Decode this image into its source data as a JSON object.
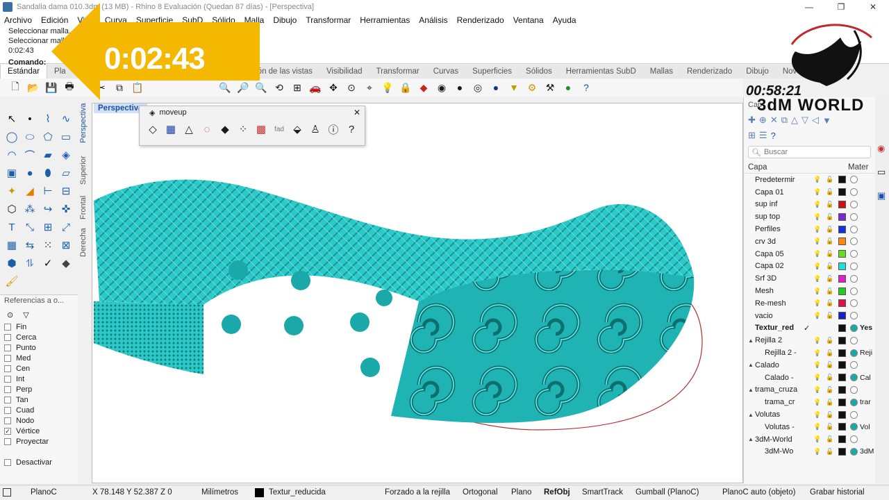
{
  "window": {
    "title": "Sandalia dama 010.3dm (13 MB) - Rhino 8 Evaluación (Quedan 87 días) - [Perspectiva]",
    "controls": [
      "—",
      "❐",
      "✕"
    ]
  },
  "menu": [
    "Archivo",
    "Edición",
    "Vista",
    "Curva",
    "Superficie",
    "SubD",
    "Sólido",
    "Malla",
    "Dibujo",
    "Transformar",
    "Herramientas",
    "Análisis",
    "Renderizado",
    "Ventana",
    "Ayuda"
  ],
  "command": {
    "history": [
      "Seleccionar malla... Pulse Intro cuando termine",
      "Seleccionar malla... Pulse Intro cuando termine",
      "0:02:43"
    ],
    "prompt_label": "Comando:",
    "prompt_value": ""
  },
  "timer": {
    "value": "0:02:43",
    "color": "#f5b800"
  },
  "tabs": [
    "Estándar",
    "Pla",
    "Disposición de las vistas",
    "Visibilidad",
    "Transformar",
    "Curvas",
    "Superficies",
    "Sólidos",
    "Herramientas SubD",
    "Mallas",
    "Renderizado",
    "Dibujo",
    "Nove"
  ],
  "viewport": {
    "active_label": "Perspectiva",
    "side_tabs": [
      "Perspectiva",
      "Superior",
      "Frontal",
      "Derecha"
    ],
    "model_color": "#2cc9c9",
    "curve_color": "#b03030"
  },
  "floating_toolbar": {
    "title": "moveup",
    "label_fad": "fad"
  },
  "osnap": {
    "header": "Referencias a o...",
    "items": [
      {
        "label": "Fin",
        "checked": false
      },
      {
        "label": "Cerca",
        "checked": false
      },
      {
        "label": "Punto",
        "checked": false
      },
      {
        "label": "Med",
        "checked": false
      },
      {
        "label": "Cen",
        "checked": false
      },
      {
        "label": "Int",
        "checked": false
      },
      {
        "label": "Perp",
        "checked": false
      },
      {
        "label": "Tan",
        "checked": false
      },
      {
        "label": "Cuad",
        "checked": false
      },
      {
        "label": "Nodo",
        "checked": false
      },
      {
        "label": "Vértice",
        "checked": true
      },
      {
        "label": "Proyectar",
        "checked": false
      }
    ],
    "deactivate": "Desactivar"
  },
  "layers_panel": {
    "tab_label": "Cap",
    "search_placeholder": "Buscar",
    "col_layer": "Capa",
    "col_material": "Mater",
    "rows": [
      {
        "name": "Predetermir",
        "indent": 0,
        "expander": "",
        "current": false,
        "color": "#111111",
        "material": "",
        "mat_color": "#ffffff"
      },
      {
        "name": "Capa 01",
        "indent": 0,
        "expander": "",
        "current": false,
        "color": "#111111",
        "material": "",
        "mat_color": "#ffffff"
      },
      {
        "name": "sup inf",
        "indent": 0,
        "expander": "",
        "current": false,
        "color": "#cc1111",
        "material": "",
        "mat_color": "#ffffff"
      },
      {
        "name": "sup top",
        "indent": 0,
        "expander": "",
        "current": false,
        "color": "#7a2bd0",
        "material": "",
        "mat_color": "#ffffff"
      },
      {
        "name": "Perfiles",
        "indent": 0,
        "expander": "",
        "current": false,
        "color": "#1133dd",
        "material": "",
        "mat_color": "#ffffff"
      },
      {
        "name": "crv 3d",
        "indent": 0,
        "expander": "",
        "current": false,
        "color": "#ff8811",
        "material": "",
        "mat_color": "#ffffff"
      },
      {
        "name": "Capa 05",
        "indent": 0,
        "expander": "",
        "current": false,
        "color": "#66dd22",
        "material": "",
        "mat_color": "#ffffff"
      },
      {
        "name": "Capa 02",
        "indent": 0,
        "expander": "",
        "current": false,
        "color": "#22dddd",
        "material": "",
        "mat_color": "#ffffff"
      },
      {
        "name": "Srf 3D",
        "indent": 0,
        "expander": "",
        "current": false,
        "color": "#dd22cc",
        "material": "",
        "mat_color": "#ffffff"
      },
      {
        "name": "Mesh",
        "indent": 0,
        "expander": "",
        "current": false,
        "color": "#22cc22",
        "material": "",
        "mat_color": "#ffffff"
      },
      {
        "name": "Re-mesh",
        "indent": 0,
        "expander": "",
        "current": false,
        "color": "#dd1144",
        "material": "",
        "mat_color": "#ffffff"
      },
      {
        "name": "vacio",
        "indent": 0,
        "expander": "",
        "current": false,
        "color": "#1122cc",
        "material": "",
        "mat_color": "#ffffff"
      },
      {
        "name": "Textur_red",
        "indent": 0,
        "expander": "",
        "current": true,
        "color": "#111111",
        "material": "Yes",
        "mat_color": "#1aa8a8"
      },
      {
        "name": "Rejilla 2",
        "indent": 0,
        "expander": "▲",
        "current": false,
        "color": "#111111",
        "material": "",
        "mat_color": "#ffffff"
      },
      {
        "name": "Rejilla 2 -",
        "indent": 1,
        "expander": "",
        "current": false,
        "color": "#111111",
        "material": "Reji",
        "mat_color": "#1aa8a8"
      },
      {
        "name": "Calado",
        "indent": 0,
        "expander": "▲",
        "current": false,
        "color": "#111111",
        "material": "",
        "mat_color": "#ffffff"
      },
      {
        "name": "Calado -",
        "indent": 1,
        "expander": "",
        "current": false,
        "color": "#111111",
        "material": "Cal",
        "mat_color": "#1aa8a8"
      },
      {
        "name": "trama_cruza",
        "indent": 0,
        "expander": "▲",
        "current": false,
        "color": "#111111",
        "material": "",
        "mat_color": "#ffffff"
      },
      {
        "name": "trama_cr",
        "indent": 1,
        "expander": "",
        "current": false,
        "color": "#111111",
        "material": "trar",
        "mat_color": "#1aa8a8"
      },
      {
        "name": "Volutas",
        "indent": 0,
        "expander": "▲",
        "current": false,
        "color": "#111111",
        "material": "",
        "mat_color": "#ffffff"
      },
      {
        "name": "Volutas -",
        "indent": 1,
        "expander": "",
        "current": false,
        "color": "#111111",
        "material": "Vol",
        "mat_color": "#1aa8a8"
      },
      {
        "name": "3dM-World",
        "indent": 0,
        "expander": "▲",
        "current": false,
        "color": "#111111",
        "material": "",
        "mat_color": "#ffffff"
      },
      {
        "name": "3dM-Wo",
        "indent": 1,
        "expander": "",
        "current": false,
        "color": "#111111",
        "material": "3dM",
        "mat_color": "#1aa8a8"
      }
    ]
  },
  "logo": {
    "text": "3dM WORLD",
    "time": "00:58:21"
  },
  "statusbar": {
    "plane": "PlanoC",
    "coords": "X 78.148 Y 52.387 Z 0",
    "units": "Milímetros",
    "layer": "Textur_reducida",
    "toggles": [
      "Forzado a la rejilla",
      "Ortogonal",
      "Plano",
      "RefObj",
      "SmartTrack",
      "Gumball (PlanoC)",
      "PlanoC auto (objeto)",
      "Grabar historial"
    ],
    "bold_toggle": "RefObj"
  }
}
